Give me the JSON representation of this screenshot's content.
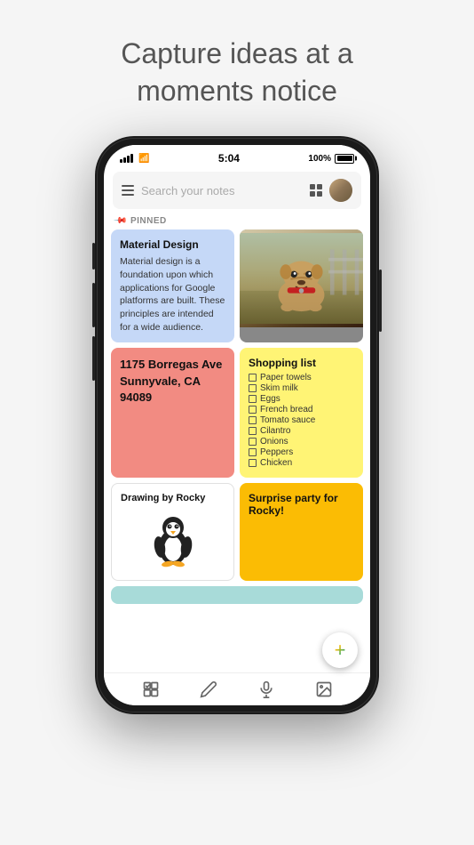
{
  "header": {
    "title_line1": "Capture ideas at a",
    "title_line2": "moments notice"
  },
  "status_bar": {
    "time": "5:04",
    "battery": "100%"
  },
  "search": {
    "placeholder": "Search your notes"
  },
  "pinned": {
    "label": "PINNED"
  },
  "notes": {
    "material_design": {
      "title": "Material Design",
      "body": "Material design is a foundation upon which applications for Google platforms are built. These principles are intended for a wide audience."
    },
    "address": {
      "body": "1175 Borregas Ave Sunnyvale, CA 94089"
    },
    "shopping": {
      "title": "Shopping list",
      "items": [
        "Paper towels",
        "Skim milk",
        "Eggs",
        "French bread",
        "Tomato sauce",
        "Cilantro",
        "Onions",
        "Peppers",
        "Chicken"
      ]
    },
    "drawing": {
      "title": "Drawing by Rocky"
    },
    "surprise": {
      "title": "Surprise party for Rocky!"
    }
  },
  "fab": {
    "label": "+"
  },
  "bottom_nav": {
    "icons": [
      "checkmark",
      "pencil",
      "microphone",
      "image"
    ]
  }
}
